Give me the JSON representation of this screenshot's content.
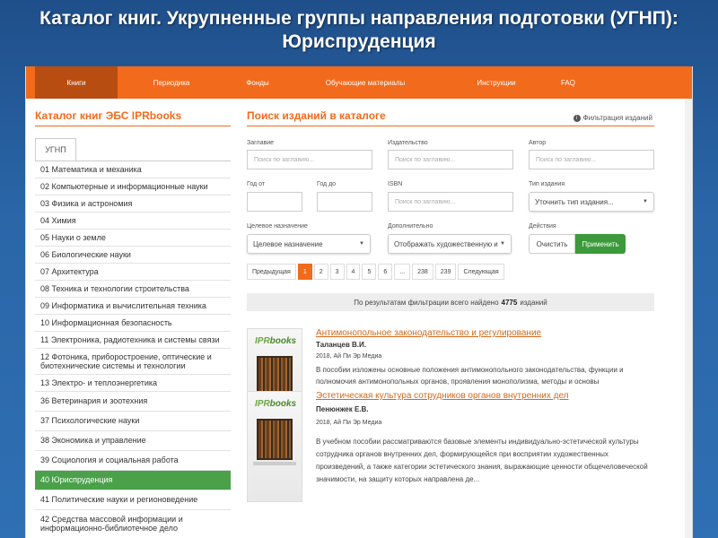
{
  "slide_title": "Каталог книг. Укрупненные группы направления подготовки (УГНП): Юриспруденция",
  "nav": [
    {
      "label": "Книги",
      "active": true
    },
    {
      "label": "Периодика",
      "active": false
    },
    {
      "label": "Фонды",
      "active": false
    },
    {
      "label": "Обучающие материалы",
      "active": false
    },
    {
      "label": "Инструкции",
      "active": false
    },
    {
      "label": "FAQ",
      "active": false
    }
  ],
  "left_title": "Каталог книг ЭБС IPRbooks",
  "tab_label": "УГНП",
  "categories": [
    "01 Математика и механика",
    "02 Компьютерные и информационные науки",
    "03 Физика и астрономия",
    "04 Химия",
    "05 Науки о земле",
    "06 Биологические науки",
    "07 Архитектура",
    "08 Техника и технологии строительства",
    "09 Информатика и вычислительная техника",
    "10 Информационная безопасность",
    "11 Электроника, радиотехника и системы связи",
    "12 Фотоника, приборостроение, оптические и биотехнические системы и технологии",
    "13 Электро- и теплоэнергетика",
    "36 Ветеринария и зоотехния",
    "37 Психологические науки",
    "38 Экономика и управление",
    "39 Социология и социальная работа",
    "40 Юриспруденция",
    "41 Политические науки и регионоведение",
    "42 Средства массовой информации и информационно-библиотечное дело"
  ],
  "active_category": 17,
  "search": {
    "title": "Поиск изданий в каталоге",
    "filter_link": "Фильтрация изданий",
    "label_title": "Заглавие",
    "label_publisher": "Издательство",
    "label_author": "Автор",
    "label_year_from": "Год от",
    "label_year_to": "Год до",
    "label_isbn": "ISBN",
    "label_type": "Тип издания",
    "label_purpose": "Целевое назначение",
    "label_extra": "Дополнительно",
    "label_actions": "Действия",
    "placeholder": "Поиск по заглавию...",
    "type_value": "Уточнить тип издания...",
    "purpose_value": "Целевое назначение",
    "extra_value": "Отображать художественную и",
    "clear_label": "Очистить",
    "apply_label": "Применить"
  },
  "pager": [
    "Предыдущая",
    "1",
    "2",
    "3",
    "4",
    "5",
    "6",
    "...",
    "238",
    "239",
    "Следующая"
  ],
  "pager_active": 1,
  "result": {
    "prefix": "По результатам фильтрации всего найдено",
    "count": "4775",
    "suffix": "изданий"
  },
  "cover_logo_a": "IPR",
  "cover_logo_b": "books",
  "books": [
    {
      "title": "Антимонопольное законодательство и регулирование",
      "author": "Таланцев В.И.",
      "pub": "2018, Ай Пи Эр Медиа",
      "desc": "В пособии изложены основные положения антимонопольного законодательства, функции и полномочия антимонопольных органов, проявления монополизма, методы и основы"
    },
    {
      "title": "Эстетическая культура сотрудников органов внутренних дел",
      "author": "Пенюнжек Е.В.",
      "pub": "2018, Ай Пи Эр Медиа",
      "desc": "В учебном пособии рассматриваются базовые элементы индивидуально-эстетической культуры сотрудника органов внутренних дел, формирующейся при восприятии художественных произведений, а также категории эстетического знания, выражающие ценности общечеловеческой значимости, на защиту которых направлена де..."
    }
  ]
}
